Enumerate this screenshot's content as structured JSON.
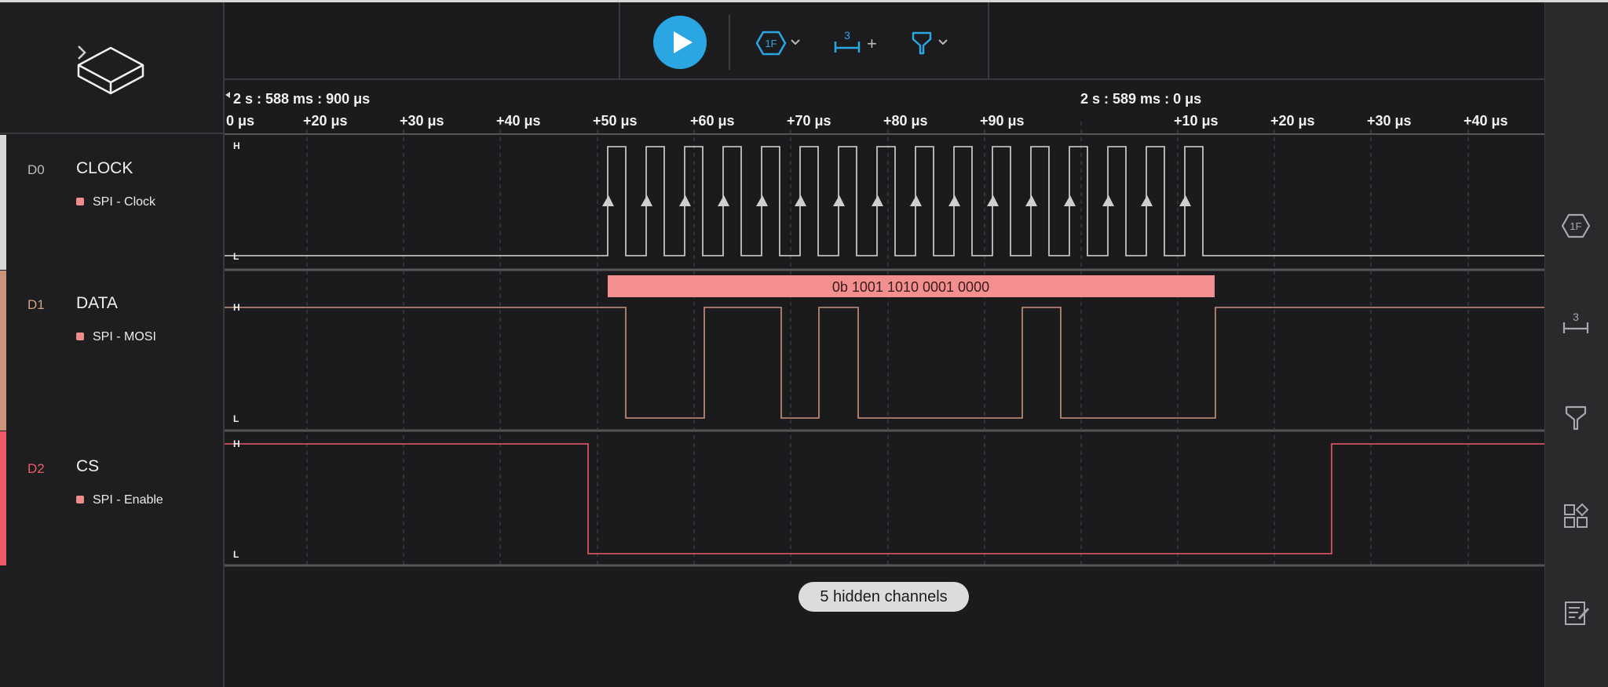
{
  "colors": {
    "clock": "#d8d8d8",
    "data": "#c9937c",
    "cs": "#ef5a6a",
    "accent_blue": "#2aa6e3",
    "decode_fill": "#f48f8f"
  },
  "logo": {
    "icon": "device-logo-icon"
  },
  "timebar": {
    "left_time": "2 s : 588 ms : 900 μs",
    "right_time": "2 s : 589 ms : 0 μs",
    "ticks": [
      "0 μs",
      "+20 μs",
      "+30 μs",
      "+40 μs",
      "+50 μs",
      "+60 μs",
      "+70 μs",
      "+80 μs",
      "+90 μs",
      "+10 μs",
      "+20 μs",
      "+30 μs",
      "+40 μs"
    ]
  },
  "channels": [
    {
      "id": "D0",
      "name": "CLOCK",
      "analyzer": "SPI - Clock"
    },
    {
      "id": "D1",
      "name": "DATA",
      "analyzer": "SPI - MOSI",
      "decoded": "0b 1001 1010 0001 0000"
    },
    {
      "id": "D2",
      "name": "CS",
      "analyzer": "SPI - Enable"
    }
  ],
  "level_labels": {
    "high": "H",
    "low": "L"
  },
  "toolbar": {
    "trigger_label": "1F",
    "measure_label": "3",
    "plus": "+",
    "icons": [
      "play-icon",
      "trigger-icon",
      "measurement-icon",
      "filter-icon"
    ]
  },
  "hidden_channels": "5 hidden channels",
  "right_sidebar": {
    "icons": [
      "trigger-icon",
      "measurement-icon",
      "filter-icon",
      "layout-icon",
      "notes-icon"
    ],
    "trigger_label": "1F",
    "measure_label": "3"
  }
}
